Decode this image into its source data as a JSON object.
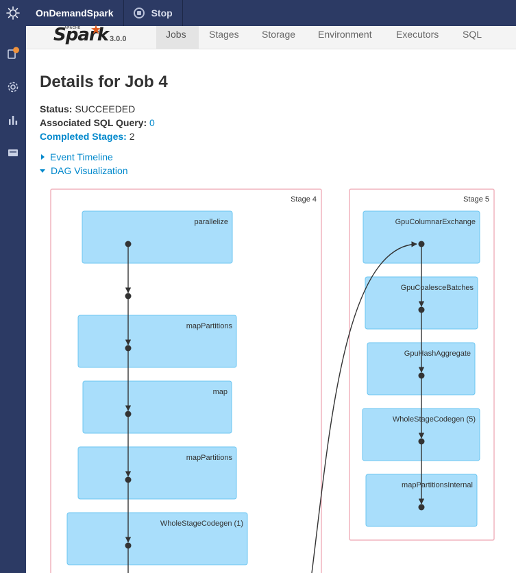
{
  "app": {
    "name": "OnDemandSpark",
    "stop_label": "Stop"
  },
  "rail": {
    "icons": [
      "notebook-icon",
      "gear-icon",
      "bar-chart-icon",
      "card-icon"
    ]
  },
  "brand": {
    "apache": "APACHE",
    "spark": "Spark",
    "version": "3.0.0"
  },
  "nav": {
    "tabs": [
      {
        "label": "Jobs",
        "active": true
      },
      {
        "label": "Stages",
        "active": false
      },
      {
        "label": "Storage",
        "active": false
      },
      {
        "label": "Environment",
        "active": false
      },
      {
        "label": "Executors",
        "active": false
      },
      {
        "label": "SQL",
        "active": false
      }
    ]
  },
  "page": {
    "title": "Details for Job 4",
    "status_label": "Status:",
    "status_value": "SUCCEEDED",
    "sql_label": "Associated SQL Query:",
    "sql_value": "0",
    "stages_label": "Completed Stages:",
    "stages_value": "2",
    "event_timeline": "Event Timeline",
    "dag_visualization": "DAG Visualization"
  },
  "dag": {
    "stages": [
      {
        "label": "Stage 4",
        "nodes": [
          "parallelize",
          "mapPartitions",
          "map",
          "mapPartitions",
          "WholeStageCodegen (1)"
        ]
      },
      {
        "label": "Stage 5",
        "nodes": [
          "GpuColumnarExchange",
          "GpuCoalesceBatches",
          "GpuHashAggregate",
          "WholeStageCodegen (5)",
          "mapPartitionsInternal"
        ]
      }
    ],
    "colors": {
      "stage_border": "#f0b3be",
      "node_fill": "#a9defb",
      "node_border": "#6cc6f0",
      "edge": "#333333"
    }
  }
}
